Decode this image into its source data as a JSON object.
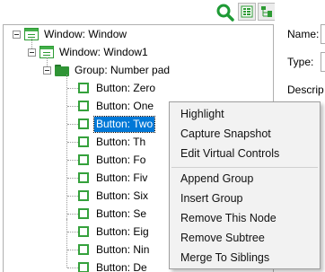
{
  "toolbar": {
    "icons": [
      "search-icon",
      "expand-all-icon",
      "tree-layout-icon"
    ]
  },
  "tree": {
    "root_label": "Window: Window",
    "child_window_label": "Window: Window1",
    "group_label": "Group: Number pad",
    "buttons": [
      "Button: Zero",
      "Button: One",
      "Button: Two",
      "Button: Th",
      "Button: Fo",
      "Button: Fiv",
      "Button: Six",
      "Button: Se",
      "Button: Eig",
      "Button: Nin",
      "Button: De"
    ],
    "selected_index": 2
  },
  "properties": {
    "name_label": "Name:",
    "type_label": "Type:",
    "description_label": "Descrip"
  },
  "context_menu": {
    "items_top": [
      "Highlight",
      "Capture Snapshot",
      "Edit Virtual Controls"
    ],
    "items_bottom": [
      "Append Group",
      "Insert Group",
      "Remove This Node",
      "Remove Subtree",
      "Merge To Siblings"
    ]
  },
  "colors": {
    "selection": "#0078d7",
    "icon_green": "#35a13c",
    "menu_bg": "#f2f2f2"
  }
}
